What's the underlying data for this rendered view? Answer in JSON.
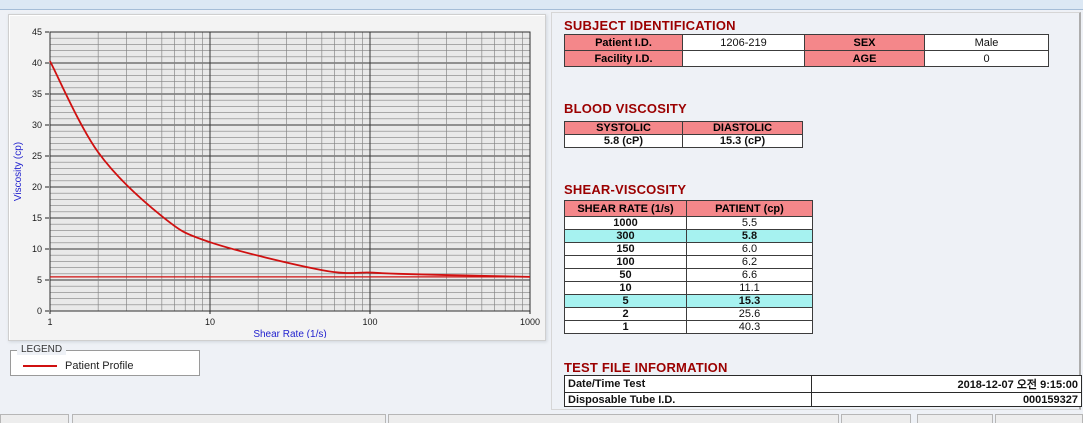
{
  "chart": {
    "legend_title": "LEGEND",
    "legend_series_label": "Patient Profile"
  },
  "chart_data": {
    "type": "line",
    "title": "",
    "xlabel": "Shear Rate (1/s)",
    "ylabel": "Viscosity (cp)",
    "x_scale": "log",
    "xlim": [
      1,
      1000
    ],
    "ylim": [
      0,
      45
    ],
    "x_major_ticks": [
      1,
      10,
      100,
      1000
    ],
    "y_major_ticks": [
      0,
      5,
      10,
      15,
      20,
      25,
      30,
      35,
      40,
      45
    ],
    "grid": true,
    "legend_position": "below-left",
    "axis_label_color": "#2323cf",
    "series": [
      {
        "name": "Patient Profile",
        "color": "#d01010",
        "x": [
          1,
          2,
          5,
          10,
          50,
          100,
          150,
          300,
          1000
        ],
        "y": [
          40.3,
          25.6,
          15.3,
          11.1,
          6.6,
          6.2,
          6.0,
          5.8,
          5.5
        ]
      }
    ],
    "reference_line_y": 5.5
  },
  "subject": {
    "title": "SUBJECT IDENTIFICATION",
    "patient_id_label": "Patient I.D.",
    "patient_id": "1206-219",
    "sex_label": "SEX",
    "sex": "Male",
    "facility_id_label": "Facility I.D.",
    "facility_id": "",
    "age_label": "AGE",
    "age": "0"
  },
  "blood": {
    "title": "BLOOD VISCOSITY",
    "systolic_label": "SYSTOLIC",
    "diastolic_label": "DIASTOLIC",
    "systolic_value": "5.8 (cP)",
    "diastolic_value": "15.3 (cP)"
  },
  "shear": {
    "title": "SHEAR-VISCOSITY",
    "col_rate": "SHEAR RATE (1/s)",
    "col_patient": "PATIENT (cp)",
    "rows": [
      {
        "rate": "1000",
        "value": "5.5",
        "highlight": false
      },
      {
        "rate": "300",
        "value": "5.8",
        "highlight": true
      },
      {
        "rate": "150",
        "value": "6.0",
        "highlight": false
      },
      {
        "rate": "100",
        "value": "6.2",
        "highlight": false
      },
      {
        "rate": "50",
        "value": "6.6",
        "highlight": false
      },
      {
        "rate": "10",
        "value": "11.1",
        "highlight": false
      },
      {
        "rate": "5",
        "value": "15.3",
        "highlight": true
      },
      {
        "rate": "2",
        "value": "25.6",
        "highlight": false
      },
      {
        "rate": "1",
        "value": "40.3",
        "highlight": false
      }
    ]
  },
  "testfile": {
    "title": "TEST FILE INFORMATION",
    "date_label": "Date/Time Test",
    "date_value": "2018-12-07  오전 9:15:00",
    "tube_label": "Disposable Tube I.D.",
    "tube_value": "000159327"
  }
}
